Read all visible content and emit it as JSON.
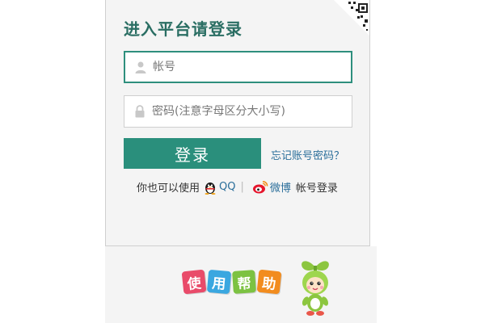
{
  "login": {
    "title": "进入平台请登录",
    "username_placeholder": "帐号",
    "password_placeholder": "密码(注意字母区分大小写)",
    "login_button": "登录",
    "forgot_link": "忘记账号密码？"
  },
  "alt_login": {
    "prefix": "你也可以使用",
    "qq_label": "QQ",
    "separator": "|",
    "weibo_label": "微博",
    "suffix": "帐号登录"
  },
  "help": {
    "tiles": [
      "使",
      "用",
      "帮",
      "助"
    ],
    "tile_colors": [
      "#e94b6a",
      "#3aa7e0",
      "#7cc242",
      "#f28c1e"
    ]
  },
  "colors": {
    "accent": "#2a8f7c",
    "title": "#2a6e63",
    "link": "#2a6e9a"
  },
  "icons": {
    "qr": "qr-code-icon",
    "user": "user-icon",
    "lock": "lock-icon",
    "qq": "qq-penguin-icon",
    "weibo": "weibo-icon",
    "mascot": "mascot-icon"
  }
}
